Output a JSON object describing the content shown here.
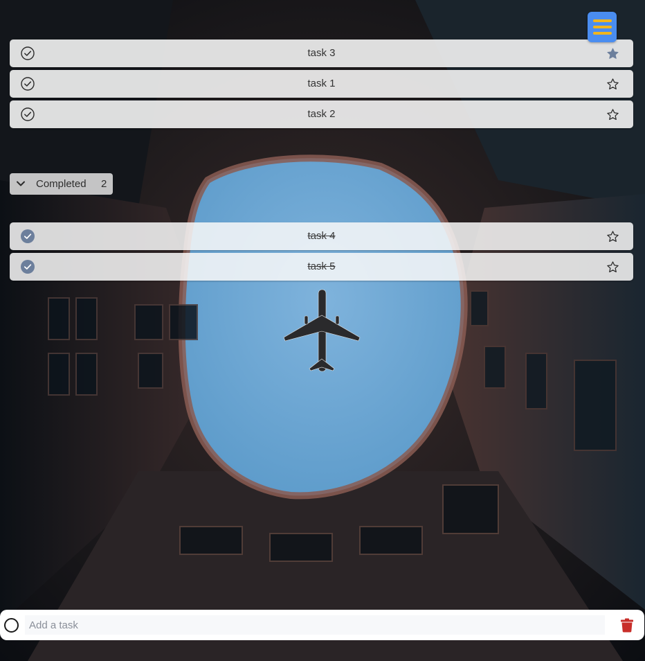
{
  "tasks": [
    {
      "label": "task 3",
      "completed": false,
      "starred": true
    },
    {
      "label": "task 1",
      "completed": false,
      "starred": false
    },
    {
      "label": "task 2",
      "completed": false,
      "starred": false
    }
  ],
  "completed_section": {
    "title": "Completed",
    "count": "2",
    "expanded": true
  },
  "completed_tasks": [
    {
      "label": "task 4",
      "completed": true,
      "starred": false
    },
    {
      "label": "task 5",
      "completed": true,
      "starred": false
    }
  ],
  "add_task": {
    "placeholder": "Add a task"
  },
  "icons": {
    "menu": "hamburger-menu-icon",
    "check_open": "check-circle-outline-icon",
    "check_done": "check-circle-filled-icon",
    "star": "star-icon",
    "chevron": "chevron-down-icon",
    "add": "circle-icon",
    "delete": "trash-icon"
  },
  "colors": {
    "menu_button": "#4a8df0",
    "menu_bars": "#f1b51c",
    "star_active": "#6c7f9c",
    "check_done": "#6c7f9c",
    "trash": "#c82e2a",
    "row_bg": "#f4f4f4"
  }
}
